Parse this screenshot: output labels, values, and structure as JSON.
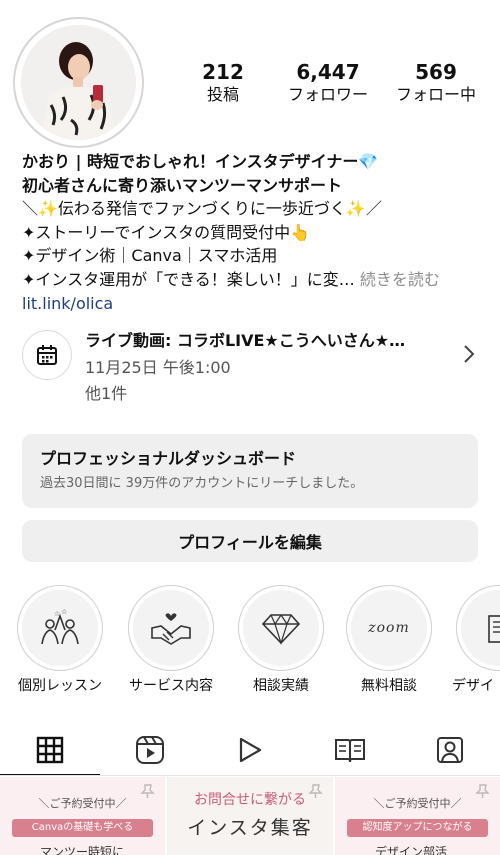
{
  "profile": {
    "stats": [
      {
        "value": "212",
        "label": "投稿"
      },
      {
        "value": "6,447",
        "label": "フォロワー"
      },
      {
        "value": "569",
        "label": "フォロー中"
      }
    ]
  },
  "bio": {
    "name": "かおり | 時短でおしゃれ！インスタデザイナー💎",
    "tagline": "初心者さんに寄り添いマンツーマンサポート",
    "lines": [
      "＼✨伝わる発信でファンづくりに一歩近づく✨／",
      "✦ストーリーでインスタの質問受付中👆",
      "✦デザイン術｜Canva｜スマホ活用",
      "✦インスタ運用が「できる！楽しい！」に変…"
    ],
    "more": "続きを読む",
    "link": "lit.link/olica"
  },
  "event": {
    "title": "ライブ動画: コラボLIVE★こうへいさん★…",
    "date": "11月25日 午後1:00",
    "more": "他1件"
  },
  "dashboard": {
    "title": "プロフェッショナルダッシュボード",
    "subtitle": "過去30日間に 39万件のアカウントにリーチしました。"
  },
  "edit_profile": "プロフィールを編集",
  "highlights": [
    {
      "label": "個別レッスン",
      "icon": "lesson-icon"
    },
    {
      "label": "サービス内容",
      "icon": "handshake-icon"
    },
    {
      "label": "相談実績",
      "icon": "diamond-icon"
    },
    {
      "label": "無料相談",
      "icon": "zoom-icon",
      "text": "zoom"
    },
    {
      "label": "デザイ",
      "icon": "book-icon"
    }
  ],
  "tabs": [
    "grid-icon",
    "reels-icon",
    "video-icon",
    "guide-icon",
    "tagged-icon"
  ],
  "grid": [
    {
      "top": "＼ご予約受付中／",
      "pill": "Canvaの基礎も学べる",
      "bottom": "マンツー時短に"
    },
    {
      "line1": "お問合せに繋がる",
      "line2": "インスタ集客"
    },
    {
      "top": "＼ご予約受付中／",
      "pill": "認知度アップにつながる",
      "bottom": "デザイン部活"
    }
  ],
  "colors": {
    "link": "#1f3f7a",
    "muted": "#8e8e8e",
    "button_bg": "#efefef",
    "tile_pink": "#d9808f"
  }
}
